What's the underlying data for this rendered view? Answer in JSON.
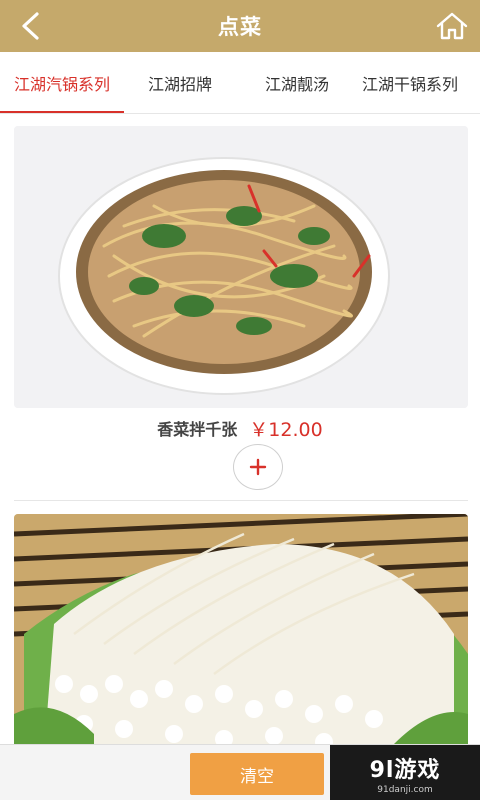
{
  "header": {
    "title": "点菜",
    "back_icon": "back-arrow-icon",
    "home_icon": "home-icon",
    "background_color": "#c5a96b"
  },
  "tabs": [
    {
      "label": "江湖汽锅系列",
      "active": true
    },
    {
      "label": "江湖招牌",
      "active": false
    },
    {
      "label": "江湖靓汤",
      "active": false
    },
    {
      "label": "江湖干锅系列",
      "active": false
    }
  ],
  "dishes": [
    {
      "name": "香菜拌千张",
      "price": "￥12.00",
      "add_icon": "plus-icon"
    },
    {
      "name": "",
      "price": ""
    }
  ],
  "footer": {
    "clear_label": "清空",
    "watermark_main": "9l游戏",
    "watermark_sub": "91danji.com"
  },
  "colors": {
    "accent": "#d8312a",
    "clear_button": "#f0a044"
  }
}
